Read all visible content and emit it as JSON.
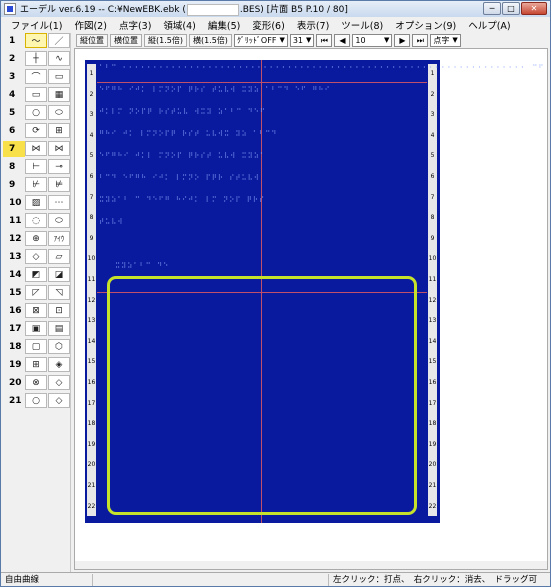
{
  "window": {
    "title_prefix": "エーデル ver.6.19 -- C:¥NewEBK.ebk (",
    "title_suffix": ".BES) [片面 B5 P.10 / 80]",
    "minimize": "─",
    "maximize": "□",
    "close": "✕"
  },
  "menu": [
    "ファイル(1)",
    "作図(2)",
    "点字(3)",
    "領域(4)",
    "編集(5)",
    "変形(6)",
    "表示(7)",
    "ツール(8)",
    "オプション(9)",
    "ヘルプ(A)"
  ],
  "toolbar": {
    "btn1": "縦位置",
    "btn2": "横位置",
    "btn3": "縦(1.5倍)",
    "btn4": "横(1.5倍)",
    "grid": "ｸﾞﾘｯﾄﾞOFF",
    "size": "31",
    "page": "10",
    "mode": "点字"
  },
  "tools": {
    "numbers": [
      "1",
      "2",
      "3",
      "4",
      "5",
      "6",
      "7",
      "8",
      "9",
      "10",
      "11",
      "12",
      "13",
      "14",
      "15",
      "16",
      "17",
      "18",
      "19",
      "20",
      "21"
    ],
    "aiu": "ｱｲｳ"
  },
  "ruler_numbers": [
    "1",
    "2",
    "3",
    "4",
    "5",
    "6",
    "7",
    "8",
    "9",
    "10",
    "11",
    "12",
    "13",
    "14",
    "15",
    "16",
    "17",
    "18",
    "19",
    "20",
    "21",
    "22"
  ],
  "status": {
    "mode": "自由曲線",
    "hint": "左クリック：打点、　右クリック：消去、　ドラッグ可"
  }
}
